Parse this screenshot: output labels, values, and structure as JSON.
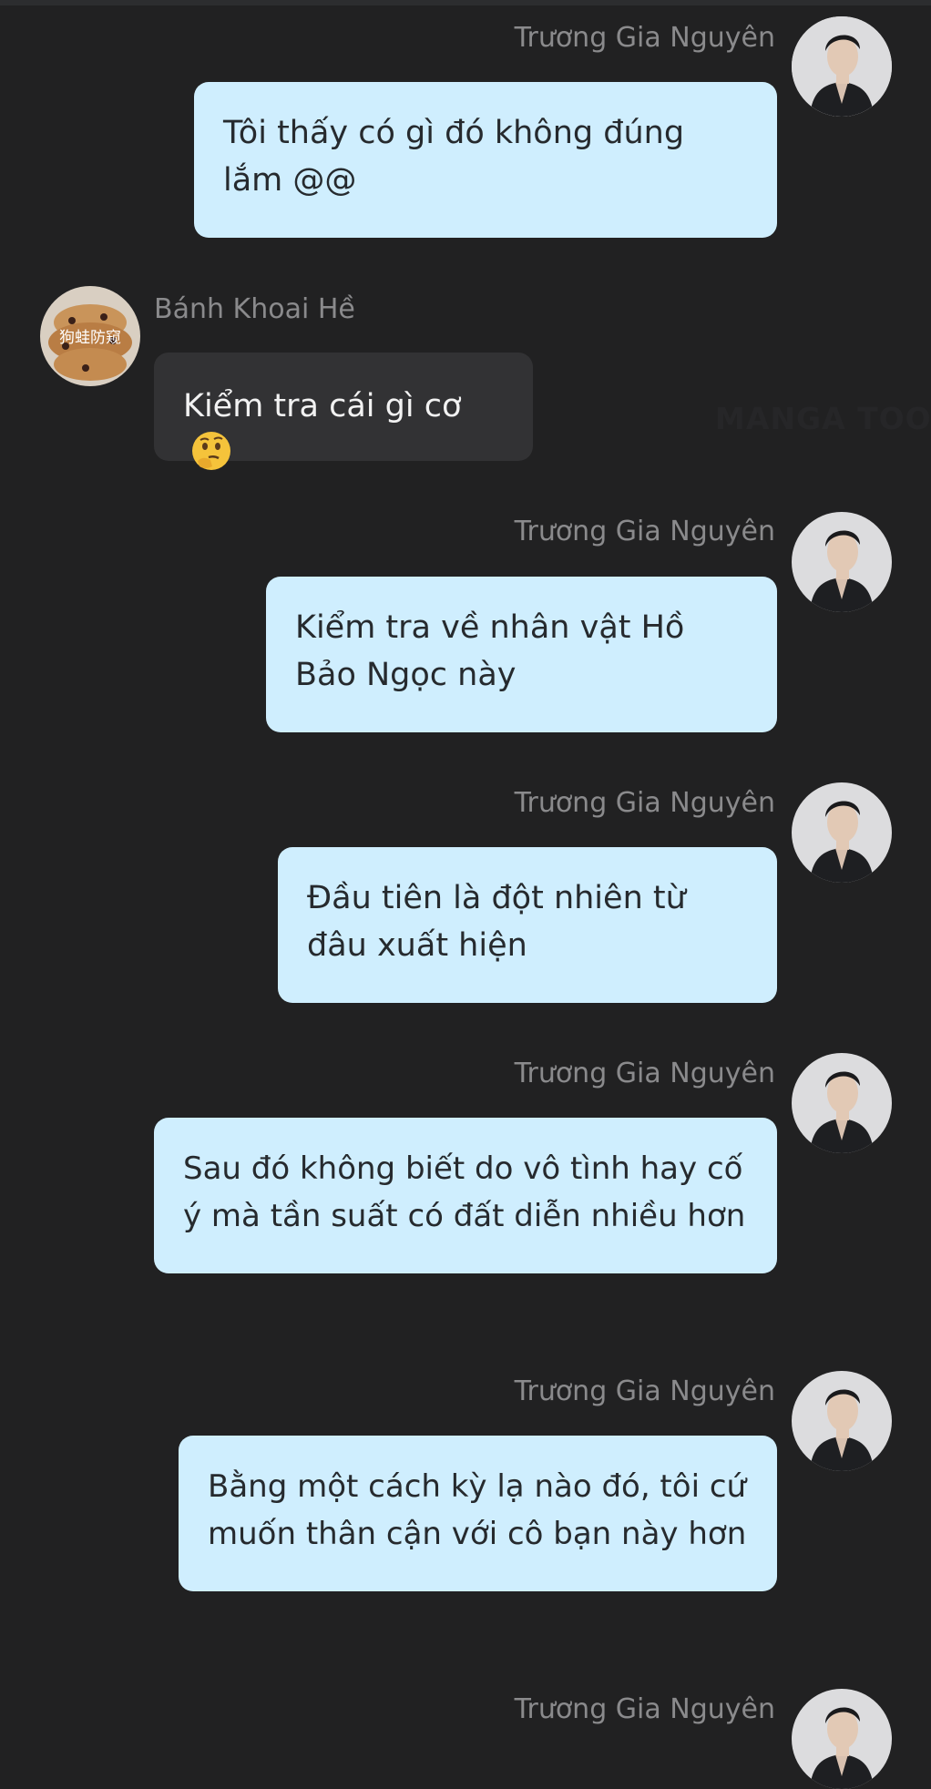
{
  "watermark": "MANGA TOON",
  "messages": [
    {
      "sender": "Trương Gia Nguyên",
      "text": "Tôi thấy có gì đó không đúng lắm @@"
    },
    {
      "sender": "Bánh Khoai Hề",
      "text": "Kiểm tra cái gì cơ",
      "avatar_text": "狗蛙防窥",
      "emoji": "thinking-face-icon"
    },
    {
      "sender": "Trương Gia Nguyên",
      "text": "Kiểm tra về nhân vật Hồ Bảo Ngọc này"
    },
    {
      "sender": "Trương Gia Nguyên",
      "text": "Đầu tiên là đột nhiên từ đâu xuất hiện"
    },
    {
      "sender": "Trương Gia Nguyên",
      "text": "Sau đó không biết do vô tình hay cố ý mà tần suất có đất diễn nhiều hơn"
    },
    {
      "sender": "Trương Gia Nguyên",
      "text": "Bằng một cách kỳ lạ nào đó, tôi cứ muốn thân cận với cô bạn này hơn"
    },
    {
      "sender": "Trương Gia Nguyên"
    }
  ],
  "colors": {
    "background": "#212122",
    "my_bubble": "#cfeefe",
    "their_bubble": "#323234",
    "name_text": "#8a8a8c"
  }
}
